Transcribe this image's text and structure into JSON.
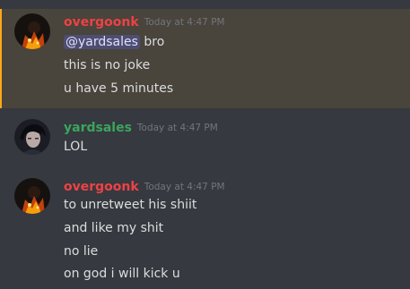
{
  "colors": {
    "background": "#36393f",
    "highlight_background": "#49443c",
    "highlight_bar": "#faa81a",
    "mention_background": "#5865f2",
    "timestamp": "#72767d",
    "message_text": "#dcddde"
  },
  "messages": [
    {
      "author": "overgoonk",
      "author_color": "#ed4245",
      "timestamp": "Today at 4:47 PM",
      "avatar_icon": "user-avatar-icon",
      "highlighted": true,
      "lines": [
        {
          "mention": "@yardsales",
          "text": " bro"
        },
        {
          "text": "this is no joke"
        },
        {
          "text": "u have 5 minutes"
        }
      ]
    },
    {
      "author": "yardsales",
      "author_color": "#3ba55d",
      "timestamp": "Today at 4:47 PM",
      "avatar_icon": "user-avatar-icon",
      "highlighted": false,
      "lines": [
        {
          "text": "LOL"
        }
      ]
    },
    {
      "author": "overgoonk",
      "author_color": "#ed4245",
      "timestamp": "Today at 4:47 PM",
      "avatar_icon": "user-avatar-icon",
      "highlighted": false,
      "lines": [
        {
          "text": "to unretweet his shiit"
        },
        {
          "text": "and like my shit"
        },
        {
          "text": "no lie"
        },
        {
          "text": "on god i will kick u"
        }
      ]
    }
  ]
}
